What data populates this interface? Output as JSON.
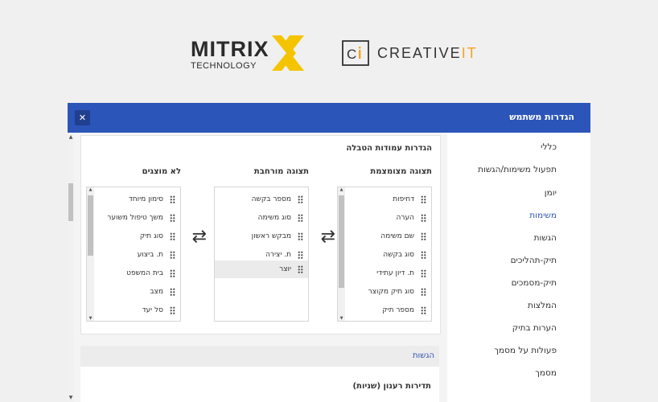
{
  "logos": {
    "mitrix_word": "MITRIX",
    "mitrix_sub": "TECHNOLOGY",
    "creative_prefix": "CREATIVE",
    "creative_suffix": "IT",
    "ci_text": "Ci"
  },
  "dialog": {
    "title": "הגדרות משתמש",
    "close_label": "✕"
  },
  "nav": {
    "items": [
      {
        "label": "כללי"
      },
      {
        "label": "תפעול משימות/הגשות"
      },
      {
        "label": "יומן"
      },
      {
        "label": "משימות",
        "active": true
      },
      {
        "label": "הגשות"
      },
      {
        "label": "תיק-תהליכים"
      },
      {
        "label": "תיק-מסמכים"
      },
      {
        "label": "המלצות"
      },
      {
        "label": "הערות בתיק"
      },
      {
        "label": "פעולות על מסמך"
      },
      {
        "label": "מסמך"
      }
    ]
  },
  "columns_card": {
    "title": "הגדרות עמודות הטבלה",
    "compact": {
      "header": "תצוגה מצומצמת",
      "items": [
        "דחיפות",
        "הערה",
        "שם משימה",
        "סוג בקשה",
        "ת. דיון עתידי",
        "סוג תיק מקוצר",
        "מספר תיק"
      ]
    },
    "expanded": {
      "header": "תצוגה מורחבת",
      "items": [
        "מספר בקשה",
        "סוג משימה",
        "מבקש ראשון",
        "ת. יצירה",
        "יוצר"
      ],
      "selected_index": 4
    },
    "hidden": {
      "header": "לא מוצגים",
      "items": [
        "סימון מיוחד",
        "משך טיפול משוער",
        "סוג תיק",
        "ת. ביצוע",
        "בית המשפט",
        "מצב",
        "סל יעד"
      ]
    },
    "swap_icon": "⇄"
  },
  "submissions": {
    "header": "הגשות",
    "subheading": "תדירות רענון (שניות)"
  },
  "colors": {
    "header_blue": "#2b55b8",
    "accent_blue": "#3155b5",
    "mitrix_yellow": "#f5c400",
    "creative_orange": "#f7a21c"
  }
}
